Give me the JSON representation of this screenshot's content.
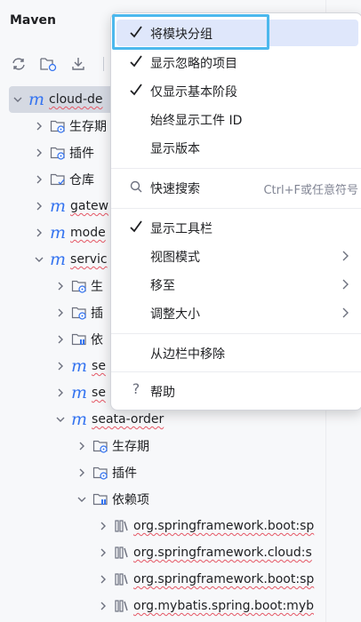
{
  "panel": {
    "title": "Maven"
  },
  "toolbar": {
    "icons": [
      "reload-icon",
      "reload-folder-icon",
      "download-icon"
    ]
  },
  "tree": {
    "rows": [
      {
        "label": "cloud-de",
        "icon": "maven-icon"
      },
      {
        "label": "生存期",
        "icon": "lifecycle-folder-icon"
      },
      {
        "label": "插件",
        "icon": "plugins-folder-icon"
      },
      {
        "label": "仓库",
        "icon": "repository-folder-icon"
      },
      {
        "label": "gatew",
        "icon": "maven-icon"
      },
      {
        "label": "mode",
        "icon": "maven-icon"
      },
      {
        "label": "servic",
        "icon": "maven-icon"
      },
      {
        "label": "生",
        "icon": "lifecycle-folder-icon"
      },
      {
        "label": "插",
        "icon": "plugins-folder-icon"
      },
      {
        "label": "依",
        "icon": "dependencies-folder-icon"
      },
      {
        "label": "se",
        "icon": "maven-icon"
      },
      {
        "label": "se",
        "icon": "maven-icon"
      },
      {
        "label": "seata-order",
        "icon": "maven-icon"
      },
      {
        "label": "生存期",
        "icon": "lifecycle-folder-icon"
      },
      {
        "label": "插件",
        "icon": "plugins-folder-icon"
      },
      {
        "label": "依赖项",
        "icon": "dependencies-folder-icon"
      },
      {
        "label": "org.springframework.boot:sp",
        "icon": "library-icon"
      },
      {
        "label": "org.springframework.cloud:s",
        "icon": "library-icon"
      },
      {
        "label": "org.springframework.boot:sp",
        "icon": "library-icon"
      },
      {
        "label": "org.mybatis.spring.boot:myb",
        "icon": "library-icon"
      }
    ]
  },
  "menu": {
    "items": [
      {
        "label": "将模块分组",
        "checked": true
      },
      {
        "label": "显示忽略的项目",
        "checked": true
      },
      {
        "label": "仅显示基本阶段",
        "checked": true
      },
      {
        "label": "始终显示工件 ID",
        "checked": false
      },
      {
        "label": "显示版本",
        "checked": false
      },
      {
        "label": "快速搜索",
        "shortcut": "Ctrl+F或任意符号",
        "icon": "search-icon"
      },
      {
        "label": "显示工具栏",
        "checked": true
      },
      {
        "label": "视图模式",
        "submenu": true
      },
      {
        "label": "移至",
        "submenu": true
      },
      {
        "label": "调整大小",
        "submenu": true
      },
      {
        "label": "从边栏中移除"
      },
      {
        "label": "帮助",
        "icon": "help-icon"
      }
    ]
  },
  "colors": {
    "accent": "#3574f0",
    "selection": "#d5d9e2",
    "focus": "#4cb8ed"
  }
}
